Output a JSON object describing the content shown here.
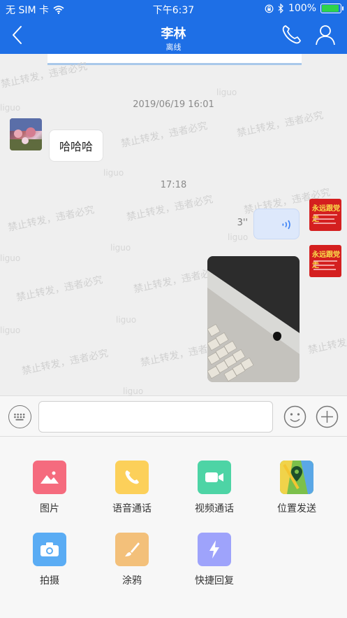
{
  "status_bar": {
    "carrier": "无 SIM 卡",
    "time": "下午6:37",
    "battery": "100%"
  },
  "header": {
    "title": "李林",
    "subtitle": "离线"
  },
  "chat": {
    "watermark_text": "禁止转发，违者必究",
    "watermark_user": "liguo",
    "timestamps": [
      "2019/06/19 16:01",
      "17:18"
    ],
    "messages": [
      {
        "side": "left",
        "type": "text",
        "text": "哈哈哈"
      },
      {
        "side": "right",
        "type": "voice",
        "duration": "3''"
      },
      {
        "side": "right",
        "type": "image"
      }
    ]
  },
  "input": {
    "placeholder": ""
  },
  "panel": {
    "items": [
      {
        "label": "图片",
        "icon": "image-icon",
        "color": "#f56b7e"
      },
      {
        "label": "语音通话",
        "icon": "phone-call-icon",
        "color": "#fcd05a"
      },
      {
        "label": "视频通话",
        "icon": "video-call-icon",
        "color": "#4dd4a5"
      },
      {
        "label": "位置发送",
        "icon": "location-icon",
        "color": "#7cc04b"
      },
      {
        "label": "拍摄",
        "icon": "camera-icon",
        "color": "#5aacf4"
      },
      {
        "label": "涂鸦",
        "icon": "brush-icon",
        "color": "#f3c07a"
      },
      {
        "label": "快捷回复",
        "icon": "quick-reply-icon",
        "color": "#9ea3fb"
      }
    ]
  }
}
